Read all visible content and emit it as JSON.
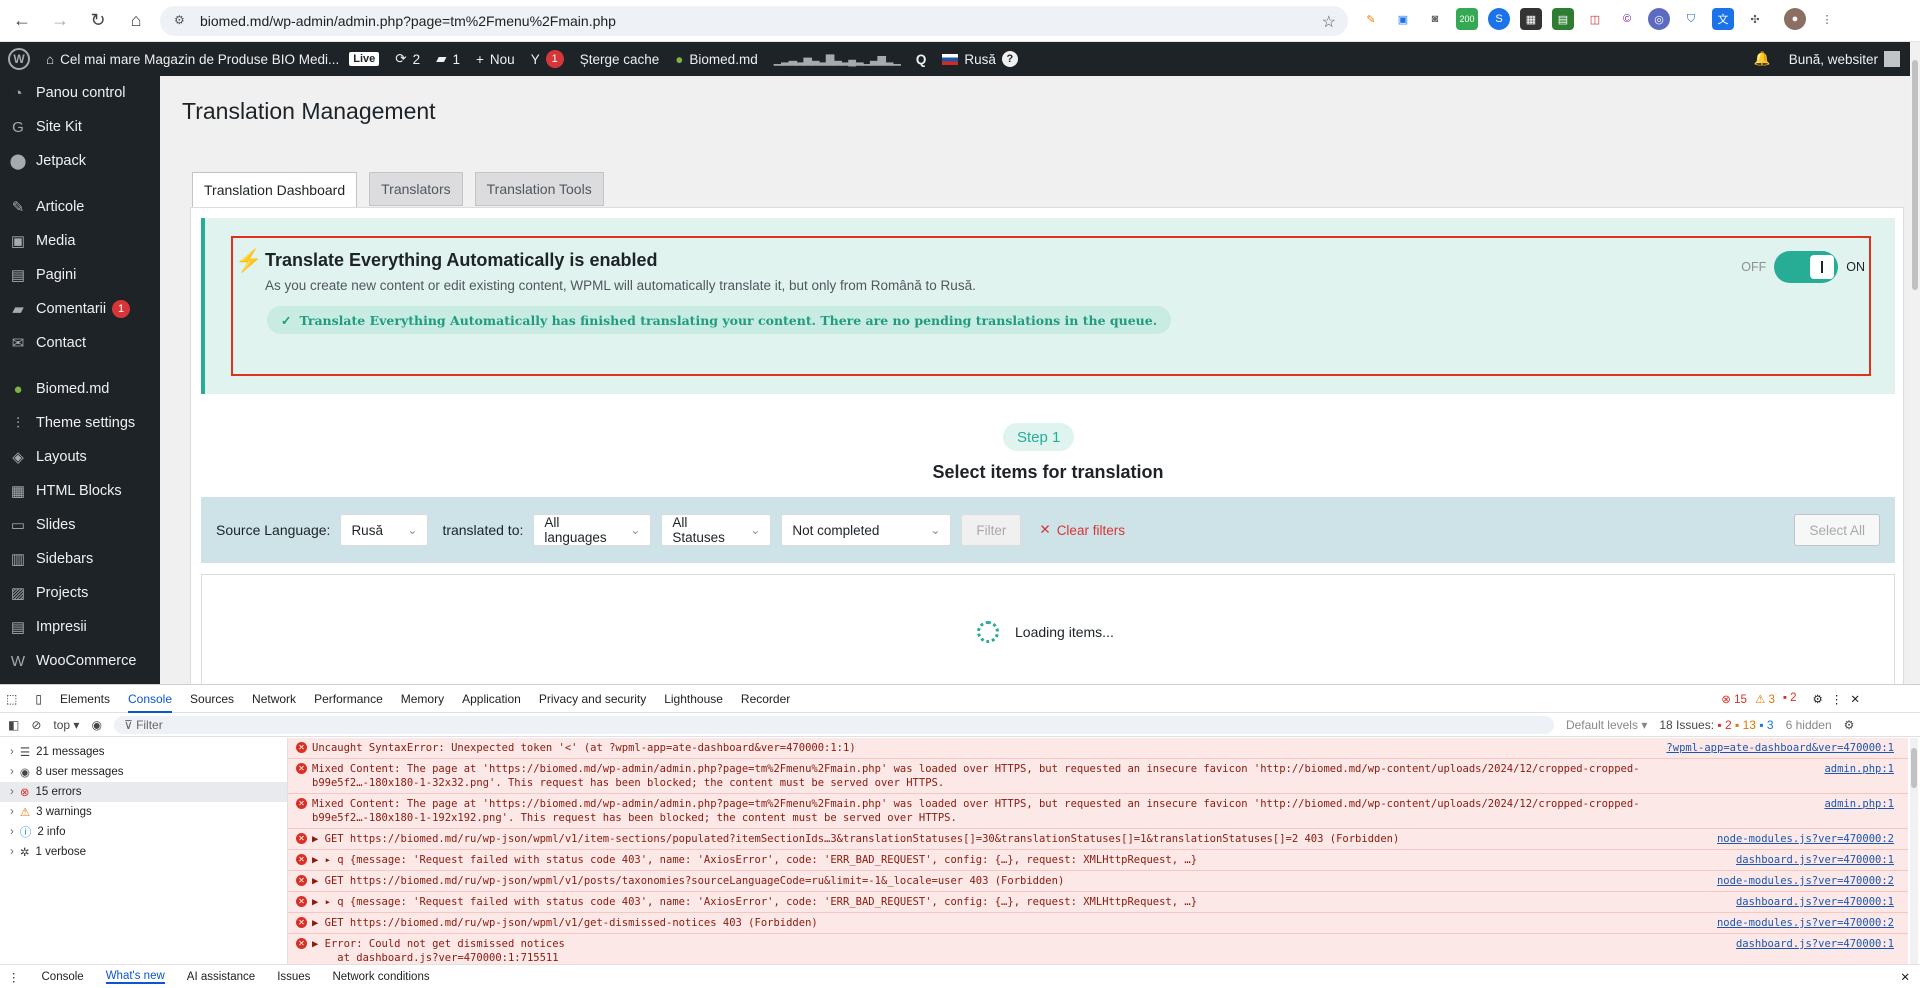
{
  "browser": {
    "url": "biomed.md/wp-admin/admin.php?page=tm%2Fmenu%2Fmain.php",
    "ext_badge": "200"
  },
  "adminbar": {
    "site_name": "Cel mai mare Magazin de Produse BIO Medi...",
    "live": "Live",
    "updates": "2",
    "comments": "1",
    "new_label": "Nou",
    "yoast_count": "1",
    "clear_cache": "Șterge cache",
    "biomed": "Biomed.md",
    "language": "Rusă",
    "help": "?",
    "greeting": "Bună, websiter"
  },
  "sidebar": {
    "items": [
      {
        "label": "Panou control",
        "icon": "dashboard-icon"
      },
      {
        "label": "Site Kit",
        "icon": "google-icon"
      },
      {
        "label": "Jetpack",
        "icon": "jetpack-icon"
      },
      {
        "label": "Articole",
        "icon": "pin-icon"
      },
      {
        "label": "Media",
        "icon": "media-icon"
      },
      {
        "label": "Pagini",
        "icon": "page-icon"
      },
      {
        "label": "Comentarii",
        "icon": "comment-icon",
        "badge": "1"
      },
      {
        "label": "Contact",
        "icon": "mail-icon"
      },
      {
        "label": "Biomed.md",
        "icon": "biomed-icon"
      },
      {
        "label": "Theme settings",
        "icon": "sliders-icon"
      },
      {
        "label": "Layouts",
        "icon": "layers-icon"
      },
      {
        "label": "HTML Blocks",
        "icon": "html-icon"
      },
      {
        "label": "Slides",
        "icon": "slides-icon"
      },
      {
        "label": "Sidebars",
        "icon": "sidebars-icon"
      },
      {
        "label": "Projects",
        "icon": "projects-icon"
      },
      {
        "label": "Impresii",
        "icon": "impressions-icon"
      },
      {
        "label": "WooCommerce",
        "icon": "woo-icon"
      }
    ]
  },
  "main": {
    "title": "Translation Management",
    "tabs": [
      "Translation Dashboard",
      "Translators",
      "Translation Tools"
    ],
    "ate": {
      "title": "Translate Everything Automatically is enabled",
      "desc": "As you create new content or edit existing content, WPML will automatically translate it, but only from Română to Rusă.",
      "status": "Translate Everything Automatically has finished translating your content. There are no pending translations in the queue.",
      "off": "OFF",
      "on": "ON"
    },
    "step": "Step 1",
    "step_title": "Select items for translation",
    "filter": {
      "source_label": "Source Language:",
      "source_value": "Rusă",
      "translated_label": "translated to:",
      "target_value": "All languages",
      "status_value": "All Statuses",
      "completion_value": "Not completed",
      "filter_btn": "Filter",
      "clear": "Clear filters",
      "select_all": "Select All"
    },
    "loading": "Loading items..."
  },
  "devtools": {
    "tabs": [
      "Elements",
      "Console",
      "Sources",
      "Network",
      "Performance",
      "Memory",
      "Application",
      "Privacy and security",
      "Lighthouse",
      "Recorder"
    ],
    "counts": {
      "errors": "15",
      "warnings": "3",
      "issues_badge": "2"
    },
    "context": "top",
    "filter_placeholder": "Filter",
    "levels": "Default levels",
    "issues": "18 Issues:",
    "issue_counts": [
      "2",
      "13",
      "3"
    ],
    "hidden": "6 hidden",
    "side": [
      {
        "label": "21 messages",
        "icon": "list-icon"
      },
      {
        "label": "8 user messages",
        "icon": "user-icon"
      },
      {
        "label": "15 errors",
        "icon": "error-icon"
      },
      {
        "label": "3 warnings",
        "icon": "warning-icon"
      },
      {
        "label": "2 info",
        "icon": "info-icon"
      },
      {
        "label": "1 verbose",
        "icon": "verbose-icon"
      }
    ],
    "logs": [
      {
        "text": "Uncaught SyntaxError: Unexpected token '<' (at ?wpml-app=ate-dashboard&ver=470000:1:1)",
        "src": "?wpml-app=ate-dashboard&ver=470000:1"
      },
      {
        "text": "Mixed Content: The page at 'https://biomed.md/wp-admin/admin.php?page=tm%2Fmenu%2Fmain.php' was loaded over HTTPS, but requested an insecure favicon 'http://biomed.md/wp-content/uploads/2024/12/cropped-cropped-b99e5f2…-180x180-1-32x32.png'. This request has been blocked; the content must be served over HTTPS.",
        "src": "admin.php:1"
      },
      {
        "text": "Mixed Content: The page at 'https://biomed.md/wp-admin/admin.php?page=tm%2Fmenu%2Fmain.php' was loaded over HTTPS, but requested an insecure favicon 'http://biomed.md/wp-content/uploads/2024/12/cropped-cropped-b99e5f2…-180x180-1-192x192.png'. This request has been blocked; the content must be served over HTTPS.",
        "src": "admin.php:1"
      },
      {
        "text": "▶ GET https://biomed.md/ru/wp-json/wpml/v1/item-sections/populated?itemSectionIds…3&translationStatuses[]=30&translationStatuses[]=1&translationStatuses[]=2 403 (Forbidden)",
        "src": "node-modules.js?ver=470000:2"
      },
      {
        "text": "▶ ▸ q {message: 'Request failed with status code 403', name: 'AxiosError', code: 'ERR_BAD_REQUEST', config: {…}, request: XMLHttpRequest, …}",
        "src": "dashboard.js?ver=470000:1"
      },
      {
        "text": "▶ GET https://biomed.md/ru/wp-json/wpml/v1/posts/taxonomies?sourceLanguageCode=ru&limit=-1&_locale=user 403 (Forbidden)",
        "src": "node-modules.js?ver=470000:2"
      },
      {
        "text": "▶ ▸ q {message: 'Request failed with status code 403', name: 'AxiosError', code: 'ERR_BAD_REQUEST', config: {…}, request: XMLHttpRequest, …}",
        "src": "dashboard.js?ver=470000:1"
      },
      {
        "text": "▶ GET https://biomed.md/ru/wp-json/wpml/v1/get-dismissed-notices 403 (Forbidden)",
        "src": "node-modules.js?ver=470000:2"
      },
      {
        "text": "▶ Error: Could not get dismissed notices\n    at dashboard.js?ver=470000:1:715511",
        "src": "dashboard.js?ver=470000:1"
      }
    ],
    "bottom_tabs": [
      "Console",
      "What's new",
      "AI assistance",
      "Issues",
      "Network conditions"
    ]
  },
  "colors": {
    "wp_dark": "#1d2327",
    "accent_teal": "#27ad95",
    "alert_red": "#e0311e"
  }
}
